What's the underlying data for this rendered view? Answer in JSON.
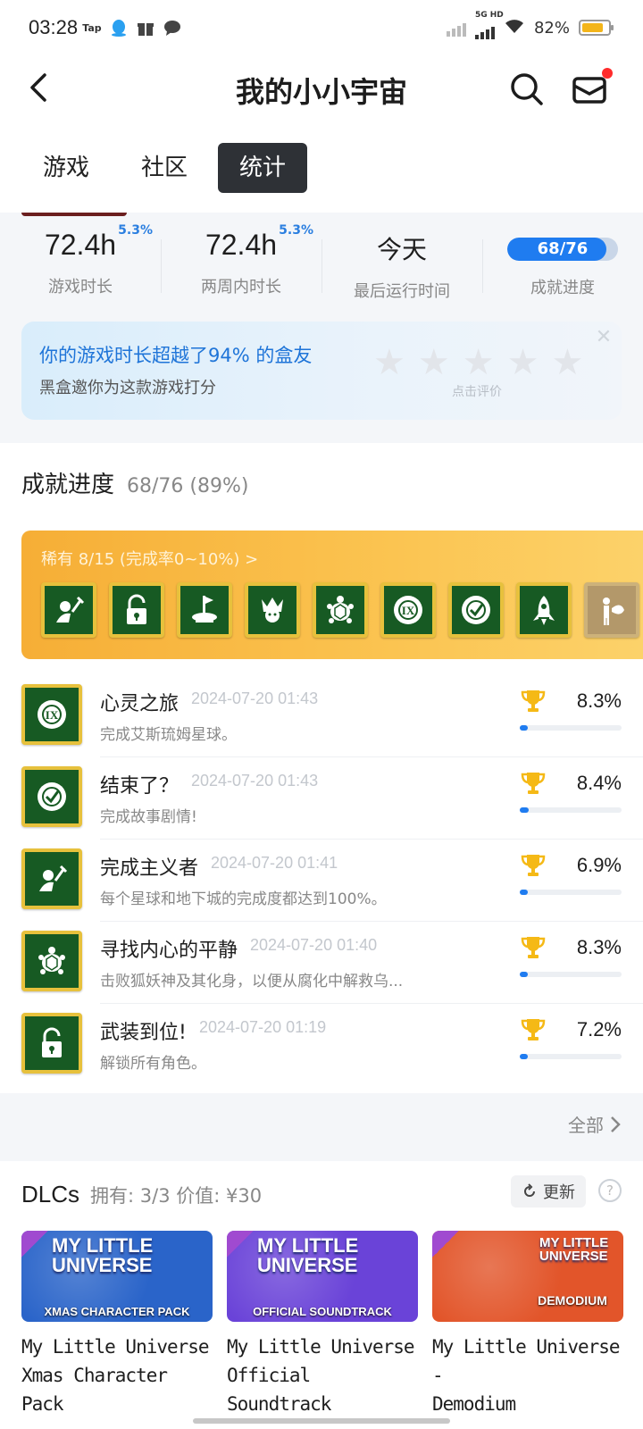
{
  "status_bar": {
    "time": "03:28",
    "app_icons": [
      "Tap",
      "qq-icon",
      "gift-icon",
      "chat-icon"
    ],
    "network": "5G HD",
    "battery": "82%",
    "battery_level": 0.82
  },
  "header": {
    "title": "我的小小宇宙"
  },
  "tabs": [
    {
      "label": "游戏",
      "active": false
    },
    {
      "label": "社区",
      "active": false
    },
    {
      "label": "统计",
      "active": true
    }
  ],
  "stats": {
    "playtime": {
      "value": "72.4h",
      "label": "游戏时长",
      "badge": "5.3%"
    },
    "two_weeks": {
      "value": "72.4h",
      "label": "两周内时长",
      "badge": "5.3%"
    },
    "last_run": {
      "value": "今天",
      "label": "最后运行时间"
    },
    "achievements": {
      "value": "68/76",
      "label": "成就进度",
      "fraction": 0.895
    }
  },
  "rating_card": {
    "title": "你的游戏时长超越了94% 的盒友",
    "subtitle": "黑盒邀你为这款游戏打分",
    "hint": "点击评价",
    "stars": 5
  },
  "achievements": {
    "title": "成就进度",
    "count": "68/76 (89%)",
    "rare_label": "稀有 8/15 (完成率0~10%) >",
    "rare_icons": [
      "dig-icon",
      "unlock-icon",
      "pedestal-icon",
      "samurai-icon",
      "turtle-icon",
      "roman-nine-icon",
      "check-shield-icon",
      "rocket-icon",
      "fish-person-icon"
    ],
    "list": [
      {
        "name": "心灵之旅",
        "date": "2024-07-20 01:43",
        "desc": "完成艾斯琉姆星球。",
        "pct": "8.3%",
        "pct_value": 8.3,
        "icon": "roman-nine-icon"
      },
      {
        "name": "结束了？",
        "date": "2024-07-20 01:43",
        "desc": "完成故事剧情!",
        "pct": "8.4%",
        "pct_value": 8.4,
        "icon": "check-shield-icon"
      },
      {
        "name": "完成主义者",
        "date": "2024-07-20 01:41",
        "desc": "每个星球和地下城的完成度都达到100%。",
        "pct": "6.9%",
        "pct_value": 6.9,
        "icon": "dig-icon"
      },
      {
        "name": "寻找内心的平静",
        "date": "2024-07-20 01:40",
        "desc": "击败狐妖神及其化身，以便从腐化中解救乌...",
        "pct": "8.3%",
        "pct_value": 8.3,
        "icon": "turtle-icon"
      },
      {
        "name": "武装到位!",
        "date": "2024-07-20 01:19",
        "desc": "解锁所有角色。",
        "pct": "7.2%",
        "pct_value": 7.2,
        "icon": "unlock-icon"
      }
    ],
    "all_label": "全部"
  },
  "dlc": {
    "title": "DLCs",
    "meta": "拥有: 3/3 价值: ¥30",
    "refresh_label": "更新",
    "help": "?",
    "items": [
      {
        "name": "My Little Universe\nXmas Character Pack",
        "banner": "XMAS CHARACTER PACK",
        "logo": "MY LITTLE UNIVERSE",
        "bg": "#2a64c9"
      },
      {
        "name": "My Little Universe\nOfficial Soundtrack",
        "banner": "OFFICIAL SOUNDTRACK",
        "logo": "MY LITTLE UNIVERSE",
        "bg": "#6a43d8"
      },
      {
        "name": "My Little Universe -\nDemodium",
        "banner": "DEMODIUM",
        "logo": "MY LITTLE UNIVERSE",
        "bg": "#e2552a"
      }
    ]
  },
  "colors": {
    "accent_blue": "#1f7cf0",
    "tab_active": "#2e3136",
    "gold": "#f6ae36",
    "icon_green": "#175a23",
    "notification_red": "#ff2b2b"
  }
}
